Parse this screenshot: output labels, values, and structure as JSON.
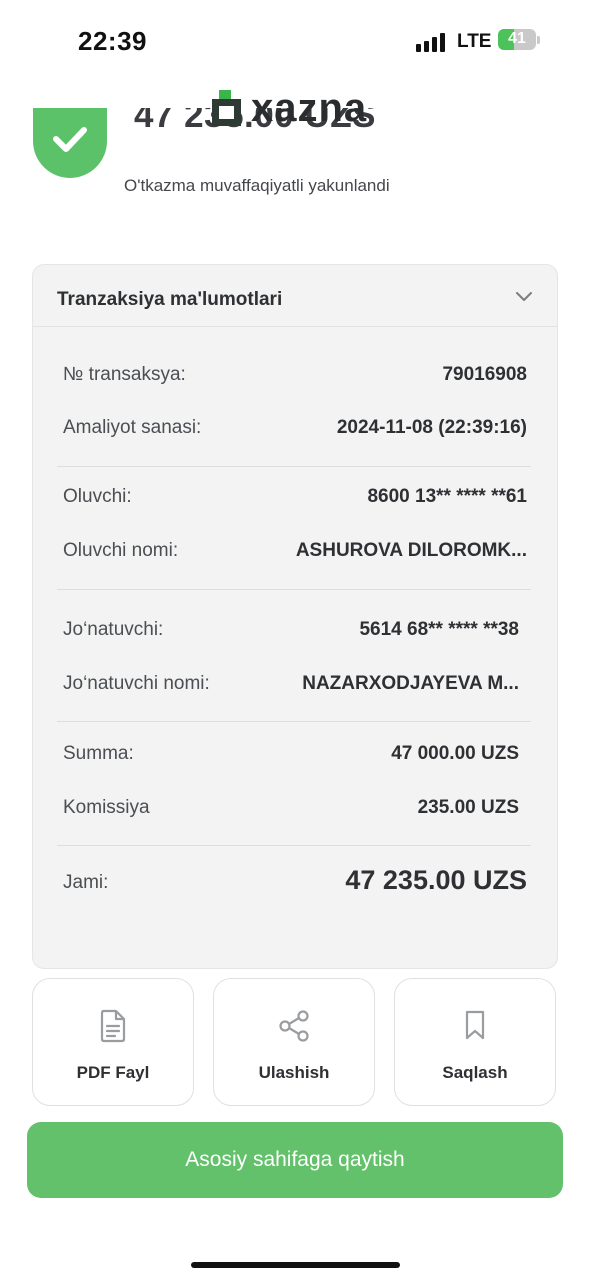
{
  "status_bar": {
    "time": "22:39",
    "network": "LTE",
    "battery": "41",
    "battery_level": 0.41
  },
  "header": {
    "amount": "47 235.00 UZS",
    "logo_text": "xazna",
    "subtitle": "O'tkazma muvaffaqiyatli yakunlandi"
  },
  "card": {
    "title": "Tranzaksiya ma'lumotlari",
    "transaction_label": "№ transaksya:",
    "transaction_value": "79016908",
    "date_label": "Amaliyot sanasi:",
    "date_value": "2024-11-08 (22:39:16)",
    "recipient_label": "Oluvchi:",
    "recipient_value": "8600 13** **** **61",
    "recipient_name_label": "Oluvchi nomi:",
    "recipient_name_value": "ASHUROVA DILOROMK...",
    "sender_label": "Jo‘natuvchi:",
    "sender_value": "5614 68** **** **38",
    "sender_name_label": "Jo‘natuvchi nomi:",
    "sender_name_value": "NAZARXODJAYEVA M...",
    "sum_label": "Summa:",
    "sum_value": "47 000.00 UZS",
    "commission_label": "Komissiya",
    "commission_value": "235.00 UZS",
    "total_label": "Jami:",
    "total_value": "47 235.00 UZS"
  },
  "actions": {
    "pdf_label": "PDF Fayl",
    "share_label": "Ulashish",
    "save_label": "Saqlash"
  },
  "home_button": "Asosiy sahifaga qaytish",
  "colors": {
    "accent_green": "#62c16a",
    "success_green": "#5cc26a",
    "card_bg": "#f2f3f2"
  }
}
